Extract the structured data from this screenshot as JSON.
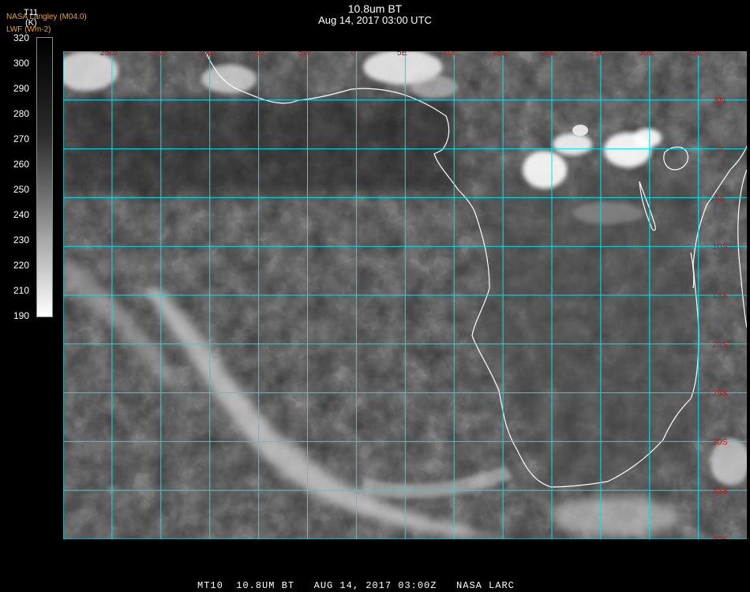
{
  "header": {
    "title": "10.8um BT",
    "datetime": "Aug 14, 2017 03:00 UTC",
    "credit_line1": "NASA Langley (M04.0)",
    "credit_line2": "LWF (Wm-2)"
  },
  "colorbar": {
    "label": "T11",
    "unit": "(K)",
    "ticks": [
      "320",
      "300",
      "290",
      "280",
      "270",
      "260",
      "250",
      "240",
      "230",
      "220",
      "210",
      "190"
    ]
  },
  "map": {
    "lon_labels": [
      "25W",
      "20W",
      "15W",
      "10W",
      "5W",
      "0",
      "5E",
      "10E",
      "15E",
      "20E",
      "25E",
      "30E",
      "35E"
    ],
    "lat_labels": [
      "5N",
      "0",
      "5S",
      "10S",
      "15S",
      "20S",
      "25S",
      "30S",
      "35S",
      "40S"
    ],
    "grid_color": "#00e5ee",
    "label_color": "#c41a1a",
    "coastline_color": "#ffffff"
  },
  "footer": {
    "text": "MT10  10.8UM BT   AUG 14, 2017 03:00Z   NASA LARC"
  }
}
